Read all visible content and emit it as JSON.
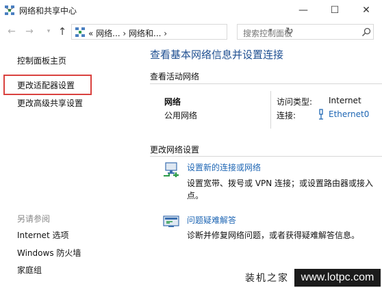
{
  "window": {
    "title": "网络和共享中心",
    "minimize_glyph": "—",
    "maximize_glyph": "☐",
    "close_glyph": "✕"
  },
  "navbar": {
    "back_glyph": "←",
    "forward_glyph": "→",
    "recent_glyph": "▾",
    "up_glyph": "↑",
    "address_path": "« 网络... › 网络和... ›",
    "address_dropdown_glyph": "▾",
    "refresh_glyph": "↻",
    "search_placeholder": "搜索控制面板"
  },
  "sidebar": {
    "home": "控制面板主页",
    "adapter_settings": "更改适配器设置",
    "advanced_sharing": "更改高级共享设置",
    "see_also_heading": "另请参阅",
    "see_also": [
      "Internet 选项",
      "Windows 防火墙",
      "家庭组"
    ],
    "highlight_color": "#d9413e"
  },
  "main": {
    "title": "查看基本网络信息并设置连接",
    "active_networks_heading": "查看活动网络",
    "network": {
      "name": "网络",
      "category": "公用网络",
      "access_type_label": "访问类型:",
      "access_type_value": "Internet",
      "connections_label": "连接:",
      "connection_value": "Ethernet0"
    },
    "change_settings_heading": "更改网络设置",
    "actions": [
      {
        "icon": "network-setup-icon",
        "link": "设置新的连接或网络",
        "description": "设置宽带、拨号或 VPN 连接；或设置路由器或接入点。"
      },
      {
        "icon": "troubleshoot-icon",
        "link": "问题疑难解答",
        "description": "诊断并修复网络问题，或者获得疑难解答信息。"
      }
    ]
  },
  "watermark": {
    "brand": "装机之家",
    "url": "www.lotpc.com"
  },
  "colors": {
    "title_blue": "#1e4f91",
    "link_blue": "#1e66b4"
  }
}
